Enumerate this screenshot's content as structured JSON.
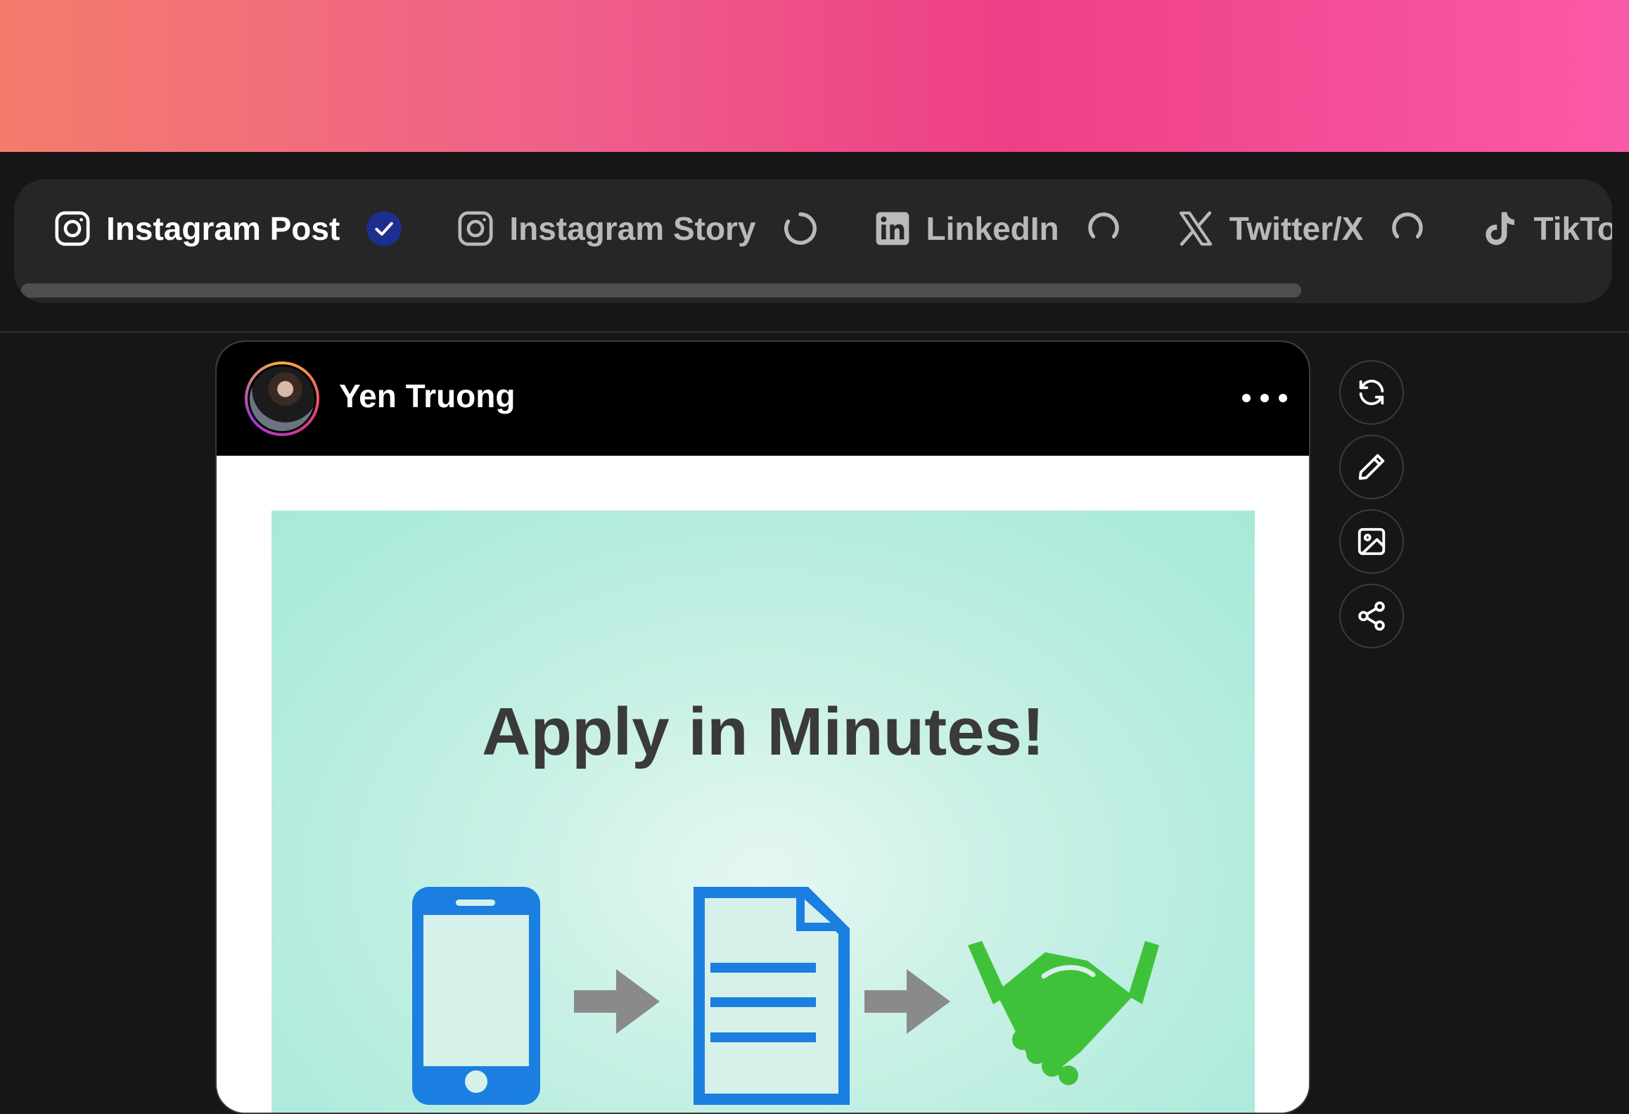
{
  "colors": {
    "banner_gradient": [
      "#f47c6c",
      "#ef5f8a",
      "#ee3f86",
      "#fb5aa6"
    ],
    "app_background": "#161616",
    "tabbar_background": "#262626",
    "check_badge": "#1c2f8f",
    "image_background": "#aeebdc",
    "icon_blue": "#1a7fe0",
    "icon_green": "#3fc23a",
    "arrow_gray": "#8a8a8a"
  },
  "tabs": [
    {
      "label": "Instagram Post",
      "icon": "instagram-icon",
      "status": "done",
      "active": true
    },
    {
      "label": "Instagram Story",
      "icon": "instagram-icon",
      "status": "loading",
      "active": false
    },
    {
      "label": "LinkedIn",
      "icon": "linkedin-icon",
      "status": "loading",
      "active": false
    },
    {
      "label": "Twitter/X",
      "icon": "x-icon",
      "status": "loading",
      "active": false
    },
    {
      "label": "TikTok",
      "icon": "tiktok-icon",
      "status": "loading",
      "active": false
    }
  ],
  "post": {
    "username": "Yen Truong",
    "image": {
      "headline": "Apply in Minutes!",
      "icons": [
        "smartphone-icon",
        "arrow-right-icon",
        "document-icon",
        "arrow-right-icon",
        "handshake-icon"
      ]
    }
  },
  "actions": [
    "refresh-icon",
    "edit-pencil-icon",
    "image-icon",
    "share-icon"
  ]
}
